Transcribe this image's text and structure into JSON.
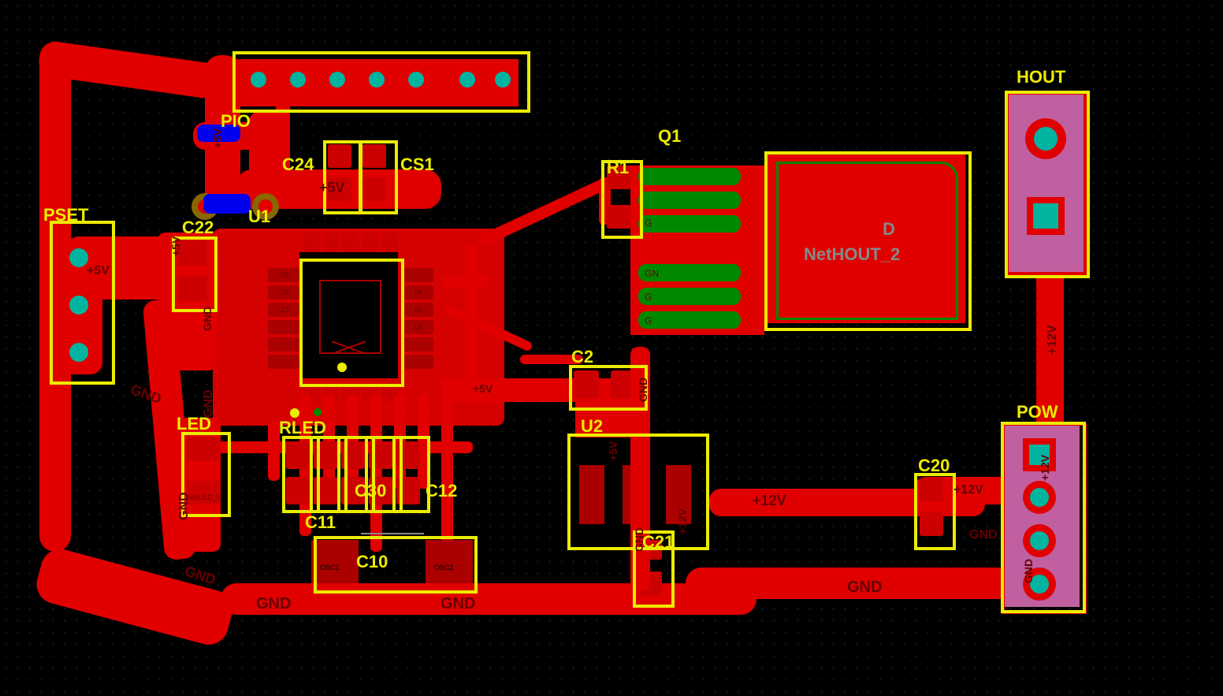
{
  "components": {
    "PSET": "PSET",
    "PIO": "PIO",
    "C22": "C22",
    "C24": "C24",
    "CS1": "CS1",
    "U1": "U1",
    "LED": "LED",
    "RLED": "RLED",
    "C11": "C11",
    "C10": "C10",
    "C12": "C12",
    "C30_like": "C30",
    "Q1": "Q1",
    "R1": "R1",
    "C2": "C2",
    "U2": "U2",
    "C21": "C21",
    "C20": "C20",
    "HOUT": "HOUT",
    "POW": "POW",
    "D": "D"
  },
  "nets": {
    "plus5v": "+5V",
    "plus12v": "+12V",
    "gnd": "GND",
    "nethout2": "NetHOUT_2",
    "g": "G",
    "gn": "GN",
    "osc1": "OSC1",
    "osc2": "OSC2"
  },
  "pins": {
    "p25": "25",
    "p26": "26",
    "p27": "27",
    "p12": "12",
    "p13": "13",
    "p14": "14"
  }
}
